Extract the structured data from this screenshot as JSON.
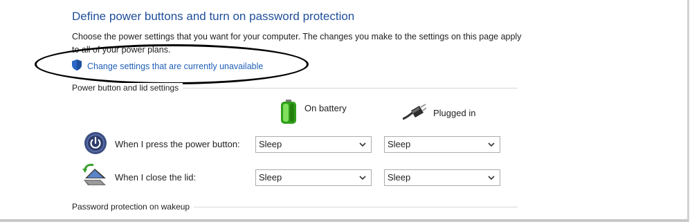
{
  "header": {
    "title": "Define power buttons and turn on password protection",
    "description": "Choose the power settings that you want for your computer. The changes you make to the settings on this page apply to all of your power plans.",
    "change_link": "Change settings that are currently unavailable"
  },
  "power_lid_section": {
    "label": "Power button and lid settings",
    "columns": {
      "battery": "On battery",
      "plugged": "Plugged in"
    },
    "rows": [
      {
        "label": "When I press the power button:",
        "battery_value": "Sleep",
        "plugged_value": "Sleep",
        "icon": "power-button-icon"
      },
      {
        "label": "When I close the lid:",
        "battery_value": "Sleep",
        "plugged_value": "Sleep",
        "icon": "laptop-lid-icon"
      }
    ]
  },
  "password_section": {
    "label": "Password protection on wakeup"
  },
  "colors": {
    "title_blue": "#1f4e9c",
    "link_blue": "#1f5fb8",
    "shield_blue": "#2b67c6",
    "battery_green": "#3cb521"
  }
}
